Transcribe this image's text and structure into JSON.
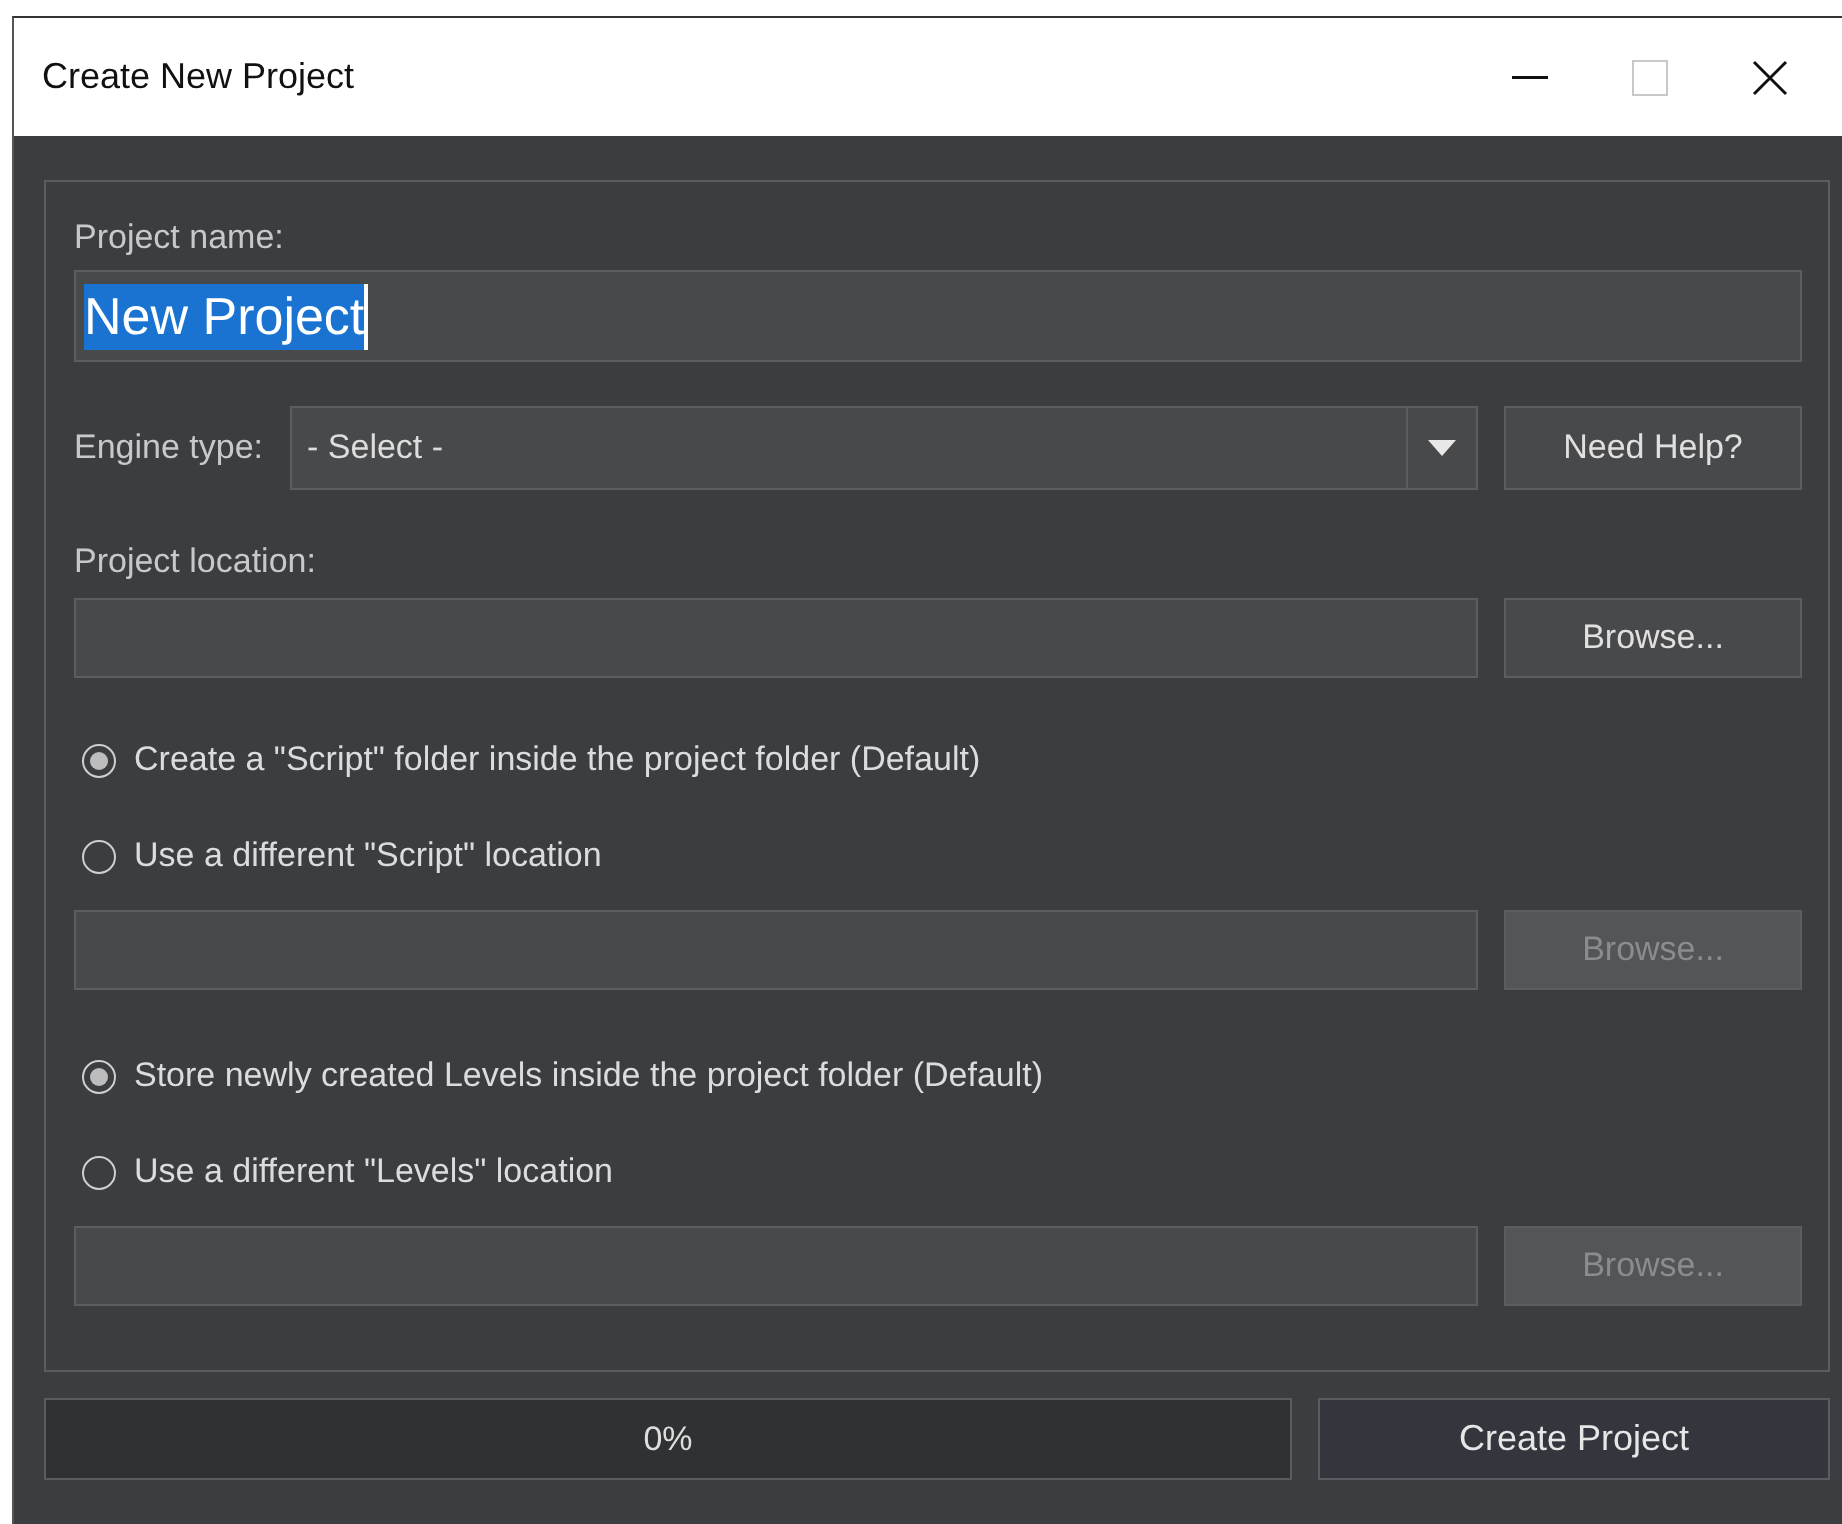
{
  "window": {
    "title": "Create New Project",
    "controls": [
      {
        "kind": "minimize",
        "disabled": false
      },
      {
        "kind": "maximize",
        "disabled": true
      },
      {
        "kind": "close",
        "disabled": false
      }
    ]
  },
  "project_name": {
    "label": "Project name:",
    "value": "New Project",
    "text_selected": true
  },
  "engine_type": {
    "label": "Engine type:",
    "value": "- Select -",
    "help_button": "Need Help?"
  },
  "project_location": {
    "label": "Project location:",
    "button": {
      "label": "Browse...",
      "disabled": false
    }
  },
  "script_options": [
    {
      "label": "Create a \"Script\" folder inside the project folder (Default)",
      "selected": true
    },
    {
      "label": "Use a different \"Script\" location",
      "selected": false
    }
  ],
  "script_location": {
    "button": {
      "label": "Browse...",
      "disabled": true
    }
  },
  "levels_options": [
    {
      "label": "Store newly created Levels inside the project folder (Default)",
      "selected": true
    },
    {
      "label": "Use a different \"Levels\" location",
      "selected": false
    }
  ],
  "levels_location": {
    "button": {
      "label": "Browse...",
      "disabled": true
    }
  },
  "progress": {
    "reading": "0%",
    "level": 0
  },
  "create_button": "Create Project"
}
